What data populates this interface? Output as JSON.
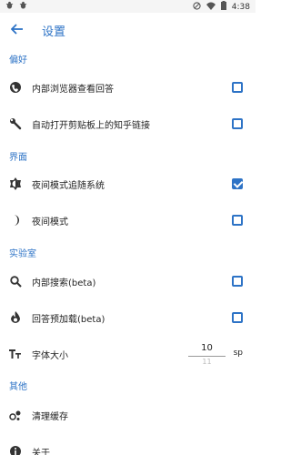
{
  "status_bar": {
    "time": "4:38",
    "left_icons": [
      "bug-icon",
      "bug-icon"
    ],
    "right_icons": [
      "signal-off-icon",
      "wifi-icon",
      "battery-icon"
    ]
  },
  "app_bar": {
    "title": "设置"
  },
  "sections": {
    "preferences": "偏好",
    "interface": "界面",
    "lab": "实验室",
    "other": "其他"
  },
  "settings": {
    "inapp_browser": {
      "label": "内部浏览器查看回答",
      "checked": false,
      "icon": "globe-icon"
    },
    "auto_open_clipboard": {
      "label": "自动打开剪贴板上的知乎链接",
      "checked": false,
      "icon": "wrench-icon"
    },
    "night_follow_system": {
      "label": "夜间模式追随系统",
      "checked": true,
      "icon": "brightness-icon"
    },
    "night_mode": {
      "label": "夜间模式",
      "checked": false,
      "icon": "moon-icon"
    },
    "internal_search": {
      "label": "内部搜索(beta)",
      "checked": false,
      "icon": "search-icon"
    },
    "answer_preload": {
      "label": "回答预加载(beta)",
      "checked": false,
      "icon": "flame-icon"
    },
    "font_size": {
      "label": "字体大小",
      "value": "10",
      "next_value": "11",
      "unit": "sp",
      "icon": "text-size-icon"
    },
    "clear_cache": {
      "label": "清理缓存",
      "icon": "bubbles-icon"
    },
    "about": {
      "label": "关于",
      "icon": "info-icon"
    }
  },
  "colors": {
    "accent": "#2d73c6",
    "text": "#222222",
    "icon": "#333333"
  }
}
